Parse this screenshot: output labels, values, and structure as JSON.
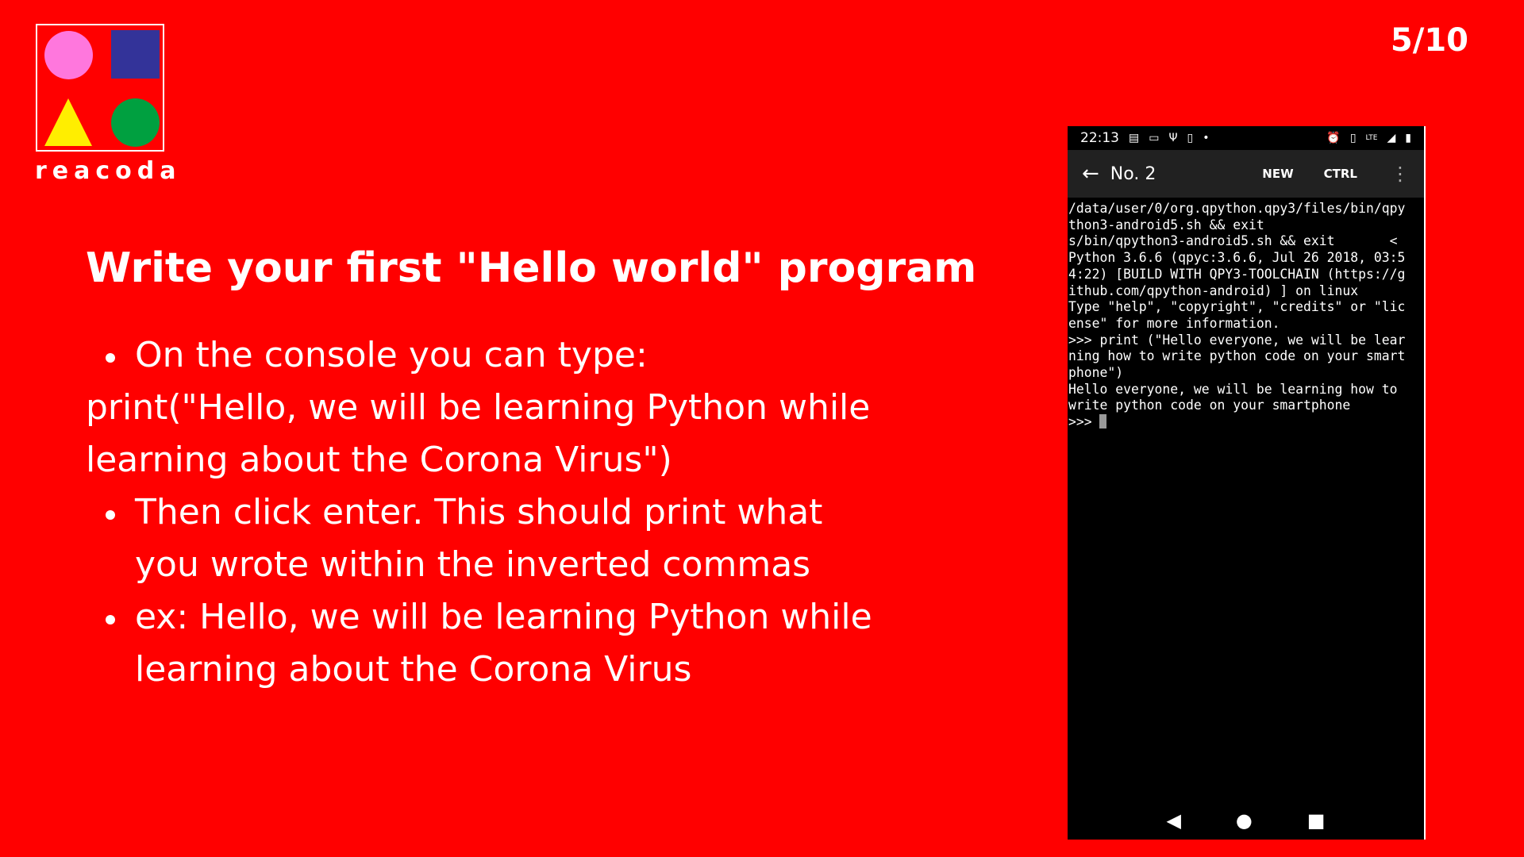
{
  "logo": {
    "text": "reacoda",
    "colors": {
      "circle": "#ff77dd",
      "square": "#333399",
      "triangle": "#ffee00",
      "dot": "#00a040"
    }
  },
  "page_number": "5/10",
  "title": "Write your first \"Hello world\" program",
  "content": {
    "bullet1": "On the console you can type:",
    "code_line": "print(\"Hello, we will be learning Python while learning about the Corona Virus\")",
    "bullet2": "Then click enter. This should print what you wrote within the inverted commas",
    "bullet3": "ex: Hello, we will be learning Python while learning about the Corona Virus"
  },
  "phone": {
    "status": {
      "time": "22:13",
      "icons": [
        "notes-icon",
        "keyboard-icon",
        "usb-icon",
        "download-icon",
        "dot-icon",
        "alarm-icon",
        "vibrate-icon",
        "lte-icon",
        "signal-icon",
        "battery-icon"
      ]
    },
    "appbar": {
      "title": "No. 2",
      "new_label": "NEW",
      "ctrl_label": "CTRL"
    },
    "terminal_lines": [
      "/data/user/0/org.qpython.qpy3/files/bin/qpy",
      "thon3-android5.sh && exit",
      "s/bin/qpython3-android5.sh && exit       <",
      "Python 3.6.6 (qpyc:3.6.6, Jul 26 2018, 03:5",
      "4:22) [BUILD WITH QPY3-TOOLCHAIN (https://g",
      "ithub.com/qpython-android) ] on linux",
      "Type \"help\", \"copyright\", \"credits\" or \"lic",
      "ense\" for more information.",
      ">>> print (\"Hello everyone, we will be lear",
      "ning how to write python code on your smart",
      "phone\")",
      "Hello everyone, we will be learning how to",
      "write python code on your smartphone"
    ],
    "prompt": ">>> "
  }
}
